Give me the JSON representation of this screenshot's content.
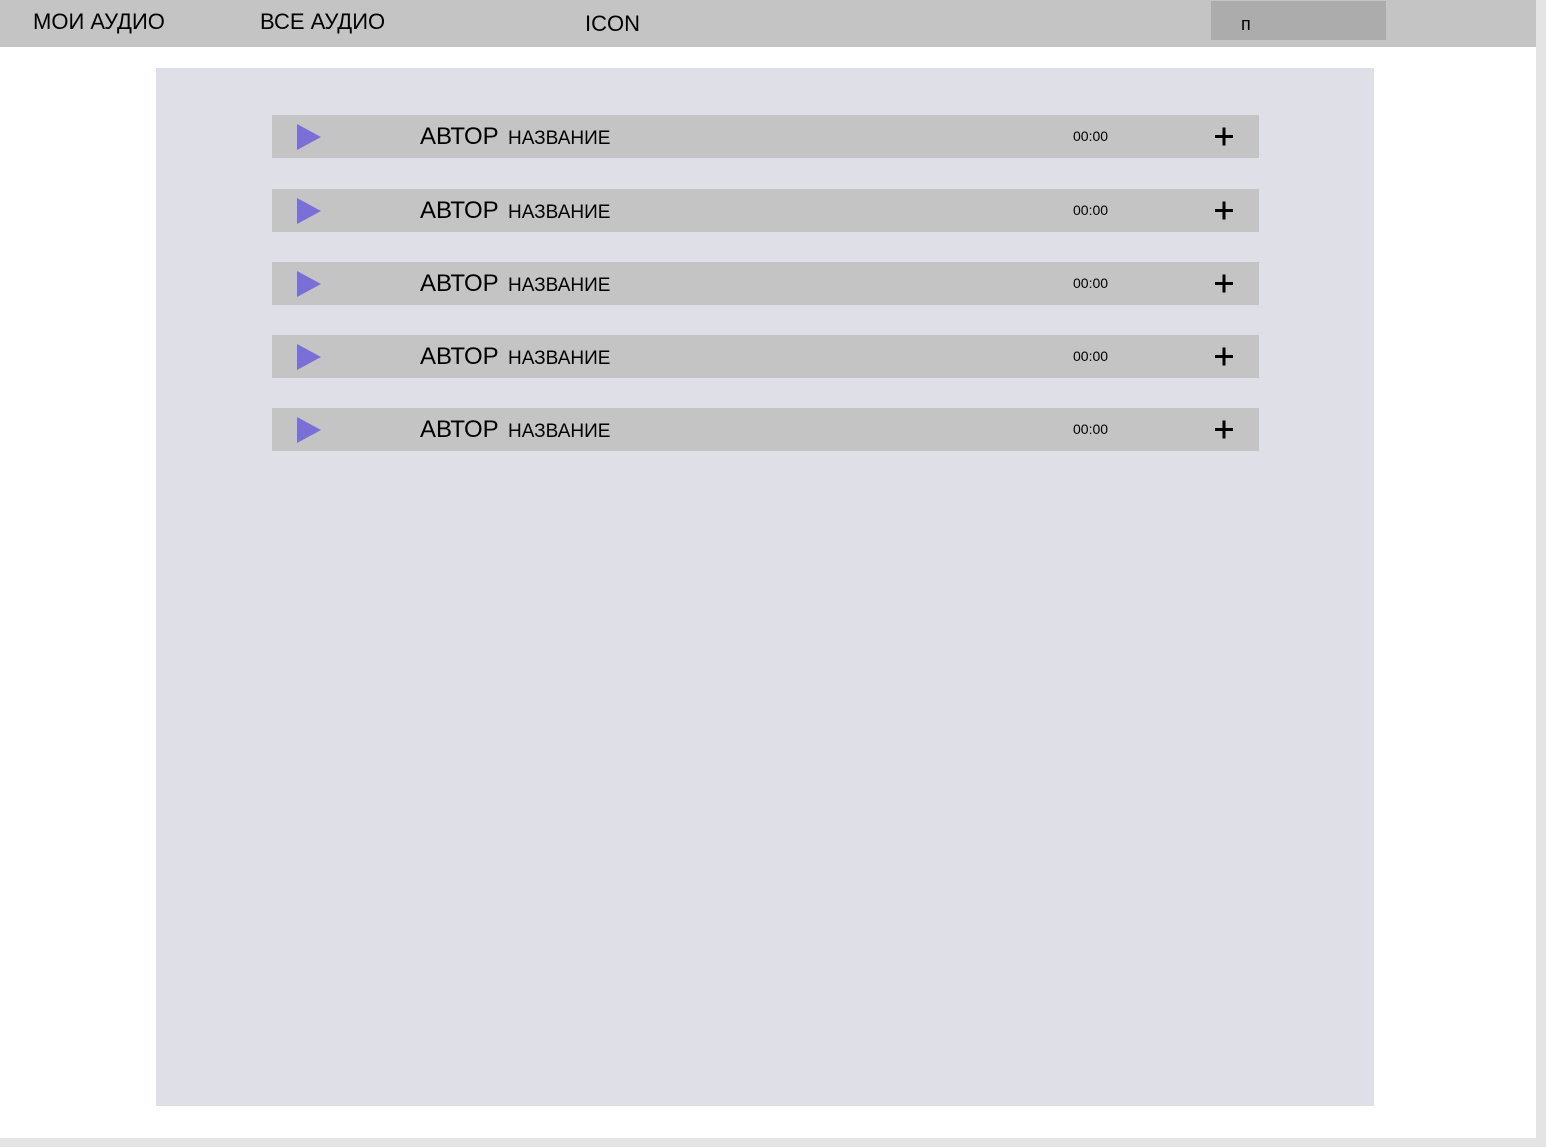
{
  "nav": {
    "my_audio": "МОИ АУДИО",
    "all_audio": "ВСЕ АУДИО",
    "icon_text": "ICON"
  },
  "search": {
    "value": "п"
  },
  "colors": {
    "topbar": "#c4c4c4",
    "search": "#acacac",
    "panel": "#dfdfe8",
    "track": "#c4c4c4",
    "play_accent": "#7a6fd6"
  },
  "tracks": [
    {
      "author": "АВТОР",
      "title": "НАЗВАНИЕ",
      "duration": "00:00",
      "play_icon": "play-icon",
      "add_icon": "plus-icon"
    },
    {
      "author": "АВТОР",
      "title": "НАЗВАНИЕ",
      "duration": "00:00",
      "play_icon": "play-icon",
      "add_icon": "plus-icon"
    },
    {
      "author": "АВТОР",
      "title": "НАЗВАНИЕ",
      "duration": "00:00",
      "play_icon": "play-icon",
      "add_icon": "plus-icon"
    },
    {
      "author": "АВТОР",
      "title": "НАЗВАНИЕ",
      "duration": "00:00",
      "play_icon": "play-icon",
      "add_icon": "plus-icon"
    },
    {
      "author": "АВТОР",
      "title": "НАЗВАНИЕ",
      "duration": "00:00",
      "play_icon": "play-icon",
      "add_icon": "plus-icon"
    }
  ]
}
